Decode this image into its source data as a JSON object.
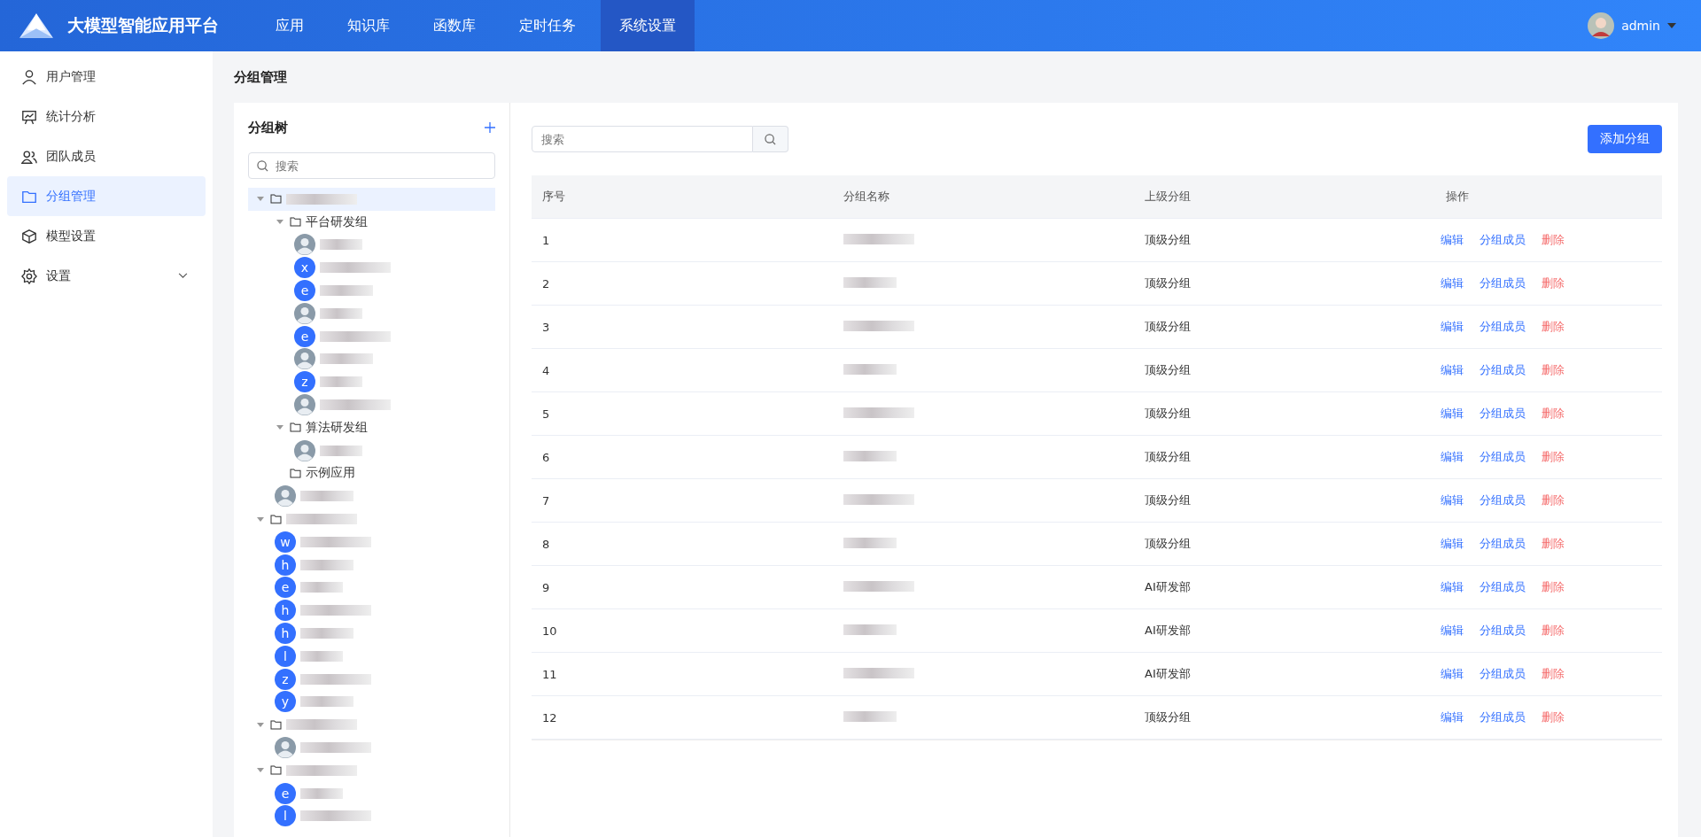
{
  "header": {
    "title": "大模型智能应用平台",
    "nav": [
      {
        "label": "应用",
        "selected": false
      },
      {
        "label": "知识库",
        "selected": false
      },
      {
        "label": "函数库",
        "selected": false
      },
      {
        "label": "定时任务",
        "selected": false
      },
      {
        "label": "系统设置",
        "selected": true
      }
    ],
    "user": {
      "name": "admin"
    }
  },
  "sidebar": {
    "items": [
      {
        "label": "用户管理",
        "selected": false
      },
      {
        "label": "统计分析",
        "selected": false
      },
      {
        "label": "团队成员",
        "selected": false
      },
      {
        "label": "分组管理",
        "selected": true
      },
      {
        "label": "模型设置",
        "selected": false
      },
      {
        "label": "设置",
        "selected": false,
        "expandable": true
      }
    ]
  },
  "page_title": "分组管理",
  "tree": {
    "title": "分组树",
    "search_placeholder": "搜索",
    "nodes": [
      {
        "kind": "folder",
        "selected": true,
        "expanded": true,
        "children": [
          {
            "kind": "folder",
            "label": "平台研发组",
            "selected": false,
            "expanded": true,
            "children": [
              {
                "kind": "member"
              },
              {
                "kind": "member",
                "initial": "x"
              },
              {
                "kind": "member",
                "initial": "e"
              },
              {
                "kind": "member"
              },
              {
                "kind": "member",
                "initial": "e"
              },
              {
                "kind": "member"
              },
              {
                "kind": "member",
                "initial": "z"
              },
              {
                "kind": "member"
              }
            ]
          },
          {
            "kind": "folder",
            "label": "算法研发组",
            "selected": false,
            "expanded": true,
            "children": [
              {
                "kind": "member"
              }
            ]
          },
          {
            "kind": "folder",
            "label": "示例应用",
            "selected": false
          },
          {
            "kind": "member"
          }
        ]
      },
      {
        "kind": "folder",
        "selected": false,
        "expanded": true,
        "children": [
          {
            "kind": "member",
            "initial": "w"
          },
          {
            "kind": "member",
            "initial": "h"
          },
          {
            "kind": "member",
            "initial": "e"
          },
          {
            "kind": "member",
            "initial": "h"
          },
          {
            "kind": "member",
            "initial": "h"
          },
          {
            "kind": "member",
            "initial": "l"
          },
          {
            "kind": "member",
            "initial": "z"
          },
          {
            "kind": "member",
            "initial": "y"
          }
        ]
      },
      {
        "kind": "folder",
        "selected": false,
        "expanded": true,
        "children": [
          {
            "kind": "member"
          }
        ]
      },
      {
        "kind": "folder",
        "selected": false,
        "expanded": true,
        "children": [
          {
            "kind": "member",
            "initial": "e"
          },
          {
            "kind": "member",
            "initial": "l"
          }
        ]
      }
    ]
  },
  "table": {
    "search_placeholder": "搜索",
    "add_button": "添加分组",
    "columns": [
      "序号",
      "分组名称",
      "上级分组",
      "操作"
    ],
    "rows": [
      {
        "index": "1",
        "parent": "顶级分组",
        "actions": [
          "编辑",
          "分组成员",
          "删除"
        ]
      },
      {
        "index": "2",
        "parent": "顶级分组",
        "actions": [
          "编辑",
          "分组成员",
          "删除"
        ]
      },
      {
        "index": "3",
        "parent": "顶级分组",
        "actions": [
          "编辑",
          "分组成员",
          "删除"
        ]
      },
      {
        "index": "4",
        "parent": "顶级分组",
        "actions": [
          "编辑",
          "分组成员",
          "删除"
        ]
      },
      {
        "index": "5",
        "parent": "顶级分组",
        "actions": [
          "编辑",
          "分组成员",
          "删除"
        ]
      },
      {
        "index": "6",
        "parent": "顶级分组",
        "actions": [
          "编辑",
          "分组成员",
          "删除"
        ]
      },
      {
        "index": "7",
        "parent": "顶级分组",
        "actions": [
          "编辑",
          "分组成员",
          "删除"
        ]
      },
      {
        "index": "8",
        "parent": "顶级分组",
        "actions": [
          "编辑",
          "分组成员",
          "删除"
        ]
      },
      {
        "index": "9",
        "parent": "AI研发部",
        "actions": [
          "编辑",
          "分组成员",
          "删除"
        ]
      },
      {
        "index": "10",
        "parent": "AI研发部",
        "actions": [
          "编辑",
          "分组成员",
          "删除"
        ]
      },
      {
        "index": "11",
        "parent": "AI研发部",
        "actions": [
          "编辑",
          "分组成员",
          "删除"
        ]
      },
      {
        "index": "12",
        "parent": "顶级分组",
        "actions": [
          "编辑",
          "分组成员",
          "删除"
        ]
      }
    ]
  }
}
